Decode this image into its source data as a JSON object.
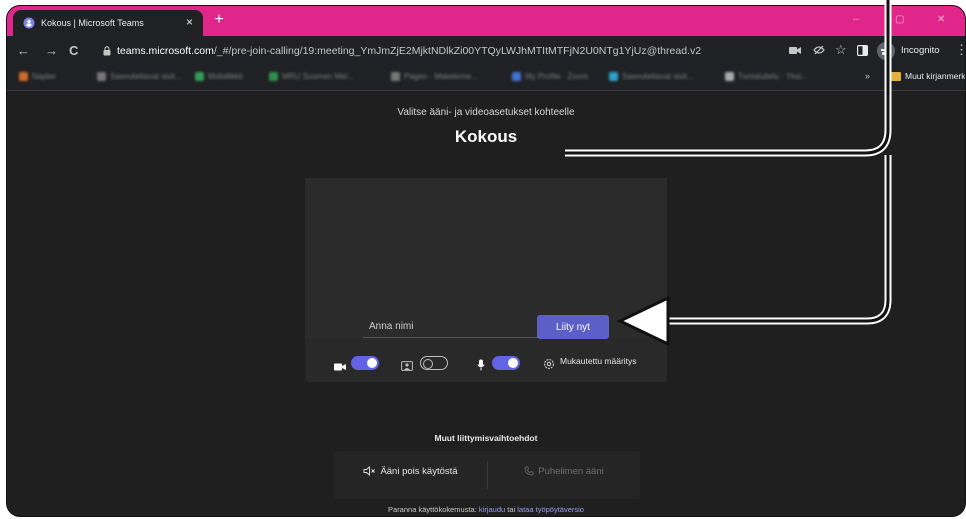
{
  "tab": {
    "title": "Kokous | Microsoft Teams",
    "close": "×",
    "new_tab": "+"
  },
  "window_buttons": {
    "minimize": "–",
    "maximize": "▢",
    "close": "✕"
  },
  "toolbar": {
    "back": "←",
    "forward": "→",
    "reload": "C",
    "url_host": "teams.microsoft.com",
    "url_path": "/_#/pre-join-calling/19:meeting_YmJmZjE2MjktNDlkZi00YTQyLWJhMTItMTFjN2U0NTg1YjUz@thread.v2",
    "incognito_label": "Incognito",
    "menu": "⋮"
  },
  "bookmarks": {
    "items": [
      {
        "label": "Napter",
        "color": "#d36b2a"
      },
      {
        "label": "Saavutettavat sivit...",
        "color": "#777777"
      },
      {
        "label": "Mobiilikkit",
        "color": "#2f9e57"
      },
      {
        "label": "MRU Suomen Mel...",
        "color": "#2f8f4a"
      },
      {
        "label": "Pagen · Makeleme...",
        "color": "#777777"
      },
      {
        "label": "My Profile · Zoom",
        "color": "#3f74d8"
      },
      {
        "label": "Saavutettavat sivit...",
        "color": "#2aa1c9"
      },
      {
        "label": "Tuntaluitelu · Yksi...",
        "color": "#aaaaaa"
      }
    ],
    "more": "»",
    "other_label": "Muut kirjanmerki"
  },
  "page": {
    "subtitle": "Valitse ääni- ja videoasetukset kohteelle",
    "meeting_title": "Kokous",
    "name_placeholder": "Anna nimi",
    "join_label": "Liity nyt",
    "device_settings_label": "Mukautettu määritys",
    "controls": {
      "camera_on": true,
      "blur_on": false,
      "mic_on": true
    },
    "other_options_title": "Muut liittymisvaihtoehdot",
    "audio_off_label": "Ääni pois käytöstä",
    "phone_audio_label": "Puhelimen ääni",
    "footer_prefix": "Paranna käyttökokemusta: ",
    "footer_link1": "kirjaudu",
    "footer_middle": " tai ",
    "footer_link2": "lataa työpöytäversio"
  },
  "colors": {
    "tab_strip": "#e0268a",
    "accent": "#5b5fc7",
    "toggle_on": "#6264e5",
    "background": "#1f1f1f"
  }
}
